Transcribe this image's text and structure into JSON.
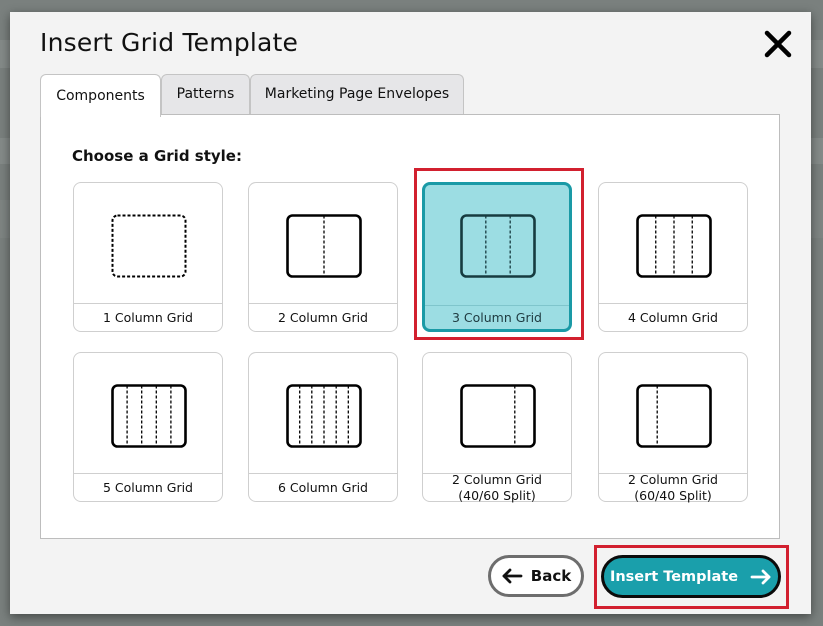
{
  "modal": {
    "title": "Insert Grid Template",
    "close_icon": "close-icon"
  },
  "tabs": [
    {
      "label": "Components",
      "active": true
    },
    {
      "label": "Patterns",
      "active": false
    },
    {
      "label": "Marketing Page Envelopes",
      "active": false
    }
  ],
  "panel": {
    "heading": "Choose a Grid style:",
    "grid_options": [
      {
        "label": "1 Column Grid",
        "label2": "",
        "selected": false,
        "dividers": [],
        "outline": "dashed"
      },
      {
        "label": "2 Column Grid",
        "label2": "",
        "selected": false,
        "dividers": [
          0.5
        ],
        "outline": "solid"
      },
      {
        "label": "3 Column Grid",
        "label2": "",
        "selected": true,
        "dividers": [
          0.333,
          0.667
        ],
        "outline": "solid"
      },
      {
        "label": "4 Column Grid",
        "label2": "",
        "selected": false,
        "dividers": [
          0.25,
          0.5,
          0.75
        ],
        "outline": "solid"
      },
      {
        "label": "5 Column Grid",
        "label2": "",
        "selected": false,
        "dividers": [
          0.2,
          0.4,
          0.6,
          0.8
        ],
        "outline": "solid"
      },
      {
        "label": "6 Column Grid",
        "label2": "",
        "selected": false,
        "dividers": [
          0.167,
          0.333,
          0.5,
          0.667,
          0.833
        ],
        "outline": "solid"
      },
      {
        "label": "2 Column Grid",
        "label2": "(40/60 Split)",
        "selected": false,
        "dividers": [
          0.73
        ],
        "outline": "solid"
      },
      {
        "label": "2 Column Grid",
        "label2": "(60/40 Split)",
        "selected": false,
        "dividers": [
          0.27
        ],
        "outline": "solid"
      }
    ]
  },
  "footer": {
    "back_label": "Back",
    "insert_label": "Insert Template"
  },
  "colors": {
    "accent": "#1a9fab",
    "selected_fill": "#9cdde3",
    "highlight": "#d2202f"
  }
}
